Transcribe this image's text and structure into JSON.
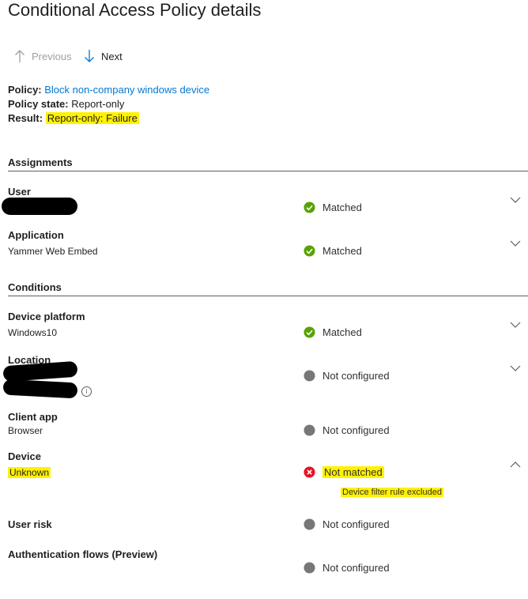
{
  "page": {
    "title": "Conditional Access Policy details"
  },
  "nav": {
    "previous": "Previous",
    "next": "Next"
  },
  "summary": {
    "policy_label": "Policy:",
    "policy_value": "Block non-company windows device",
    "state_label": "Policy state:",
    "state_value": "Report-only",
    "result_label": "Result:",
    "result_value": "Report-only: Failure"
  },
  "assignments": {
    "title": "Assignments",
    "rows": [
      {
        "name": "User",
        "value": "",
        "status": "Matched",
        "status_type": "success"
      },
      {
        "name": "Application",
        "value": "Yammer Web Embed",
        "status": "Matched",
        "status_type": "success"
      }
    ]
  },
  "conditions": {
    "title": "Conditions",
    "rows": [
      {
        "name": "Device platform",
        "value": "Windows10",
        "status": "Matched",
        "status_type": "success"
      },
      {
        "name": "Location",
        "value": "",
        "status": "Not configured",
        "status_type": "neutral"
      },
      {
        "name": "Client app",
        "value": "Browser",
        "status": "Not configured",
        "status_type": "neutral"
      },
      {
        "name": "Device",
        "value": "Unknown",
        "status": "Not matched",
        "status_type": "error",
        "detail": "Device filter rule excluded"
      },
      {
        "name": "User risk",
        "value": "",
        "status": "Not configured",
        "status_type": "neutral"
      },
      {
        "name": "Authentication flows (Preview)",
        "value": "",
        "status": "Not configured",
        "status_type": "neutral"
      }
    ]
  },
  "icons": {
    "up_arrow": "arrow-up-icon",
    "down_arrow": "arrow-down-icon",
    "success": "check-circle-icon",
    "neutral": "gray-dot-icon",
    "error": "error-circle-icon",
    "chevron_down": "chevron-down-icon",
    "chevron_up": "chevron-up-icon",
    "info": "info-icon"
  },
  "colors": {
    "link": "#0078d4",
    "success": "#57a300",
    "neutral": "#797775",
    "error": "#e81123",
    "highlight": "#fff200"
  }
}
